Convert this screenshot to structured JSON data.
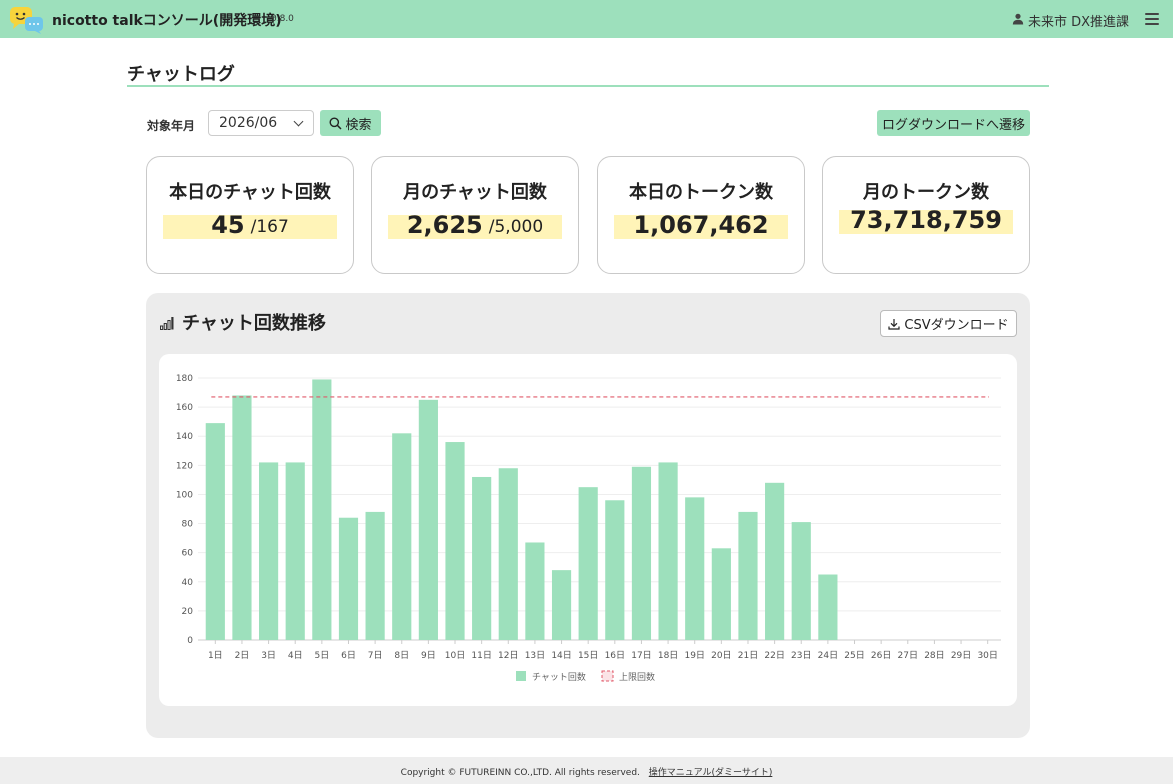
{
  "header": {
    "app_title": "nicotto talkコンソール(開発環境)",
    "version": "0.8.0",
    "user_name": "未来市 DX推進課"
  },
  "page": {
    "title": "チャットログ"
  },
  "filter": {
    "label": "対象年月",
    "month_value": "2026/06",
    "search_label": "検索",
    "goto_download_label": "ログダウンロードへ遷移"
  },
  "stats": [
    {
      "label": "本日のチャット回数",
      "value": "45",
      "limit": "/167"
    },
    {
      "label": "月のチャット回数",
      "value": "2,625",
      "limit": "/5,000"
    },
    {
      "label": "本日のトークン数",
      "value": "1,067,462",
      "limit": ""
    },
    {
      "label": "月のトークン数",
      "value": "73,718,759",
      "limit": ""
    }
  ],
  "chart_section": {
    "title": "チャット回数推移",
    "csv_label": "CSVダウンロード"
  },
  "chart_data": {
    "type": "bar",
    "categories": [
      "1日",
      "2日",
      "3日",
      "4日",
      "5日",
      "6日",
      "7日",
      "8日",
      "9日",
      "10日",
      "11日",
      "12日",
      "13日",
      "14日",
      "15日",
      "16日",
      "17日",
      "18日",
      "19日",
      "20日",
      "21日",
      "22日",
      "23日",
      "24日",
      "25日",
      "26日",
      "27日",
      "28日",
      "29日",
      "30日"
    ],
    "series": [
      {
        "name": "チャット回数",
        "values": [
          149,
          168,
          122,
          122,
          179,
          84,
          88,
          142,
          165,
          136,
          112,
          118,
          67,
          48,
          105,
          96,
          119,
          122,
          98,
          63,
          88,
          108,
          81,
          45,
          null,
          null,
          null,
          null,
          null,
          null
        ]
      }
    ],
    "limit_line": {
      "name": "上限回数",
      "value": 167
    },
    "ylim": [
      0,
      180
    ],
    "yticks": [
      0,
      20,
      40,
      60,
      80,
      100,
      120,
      140,
      160,
      180
    ],
    "grid": true,
    "legend_position": "bottom",
    "colors": {
      "bar": "#9de0bc",
      "limit": "#e05a6a"
    }
  },
  "footer": {
    "copyright": "Copyright © FUTUREINN CO.,LTD. All rights reserved.",
    "manual_link": "操作マニュアル(ダミーサイト)"
  },
  "colors": {
    "accent": "#9de0bc",
    "highlight": "#fff4b8"
  }
}
